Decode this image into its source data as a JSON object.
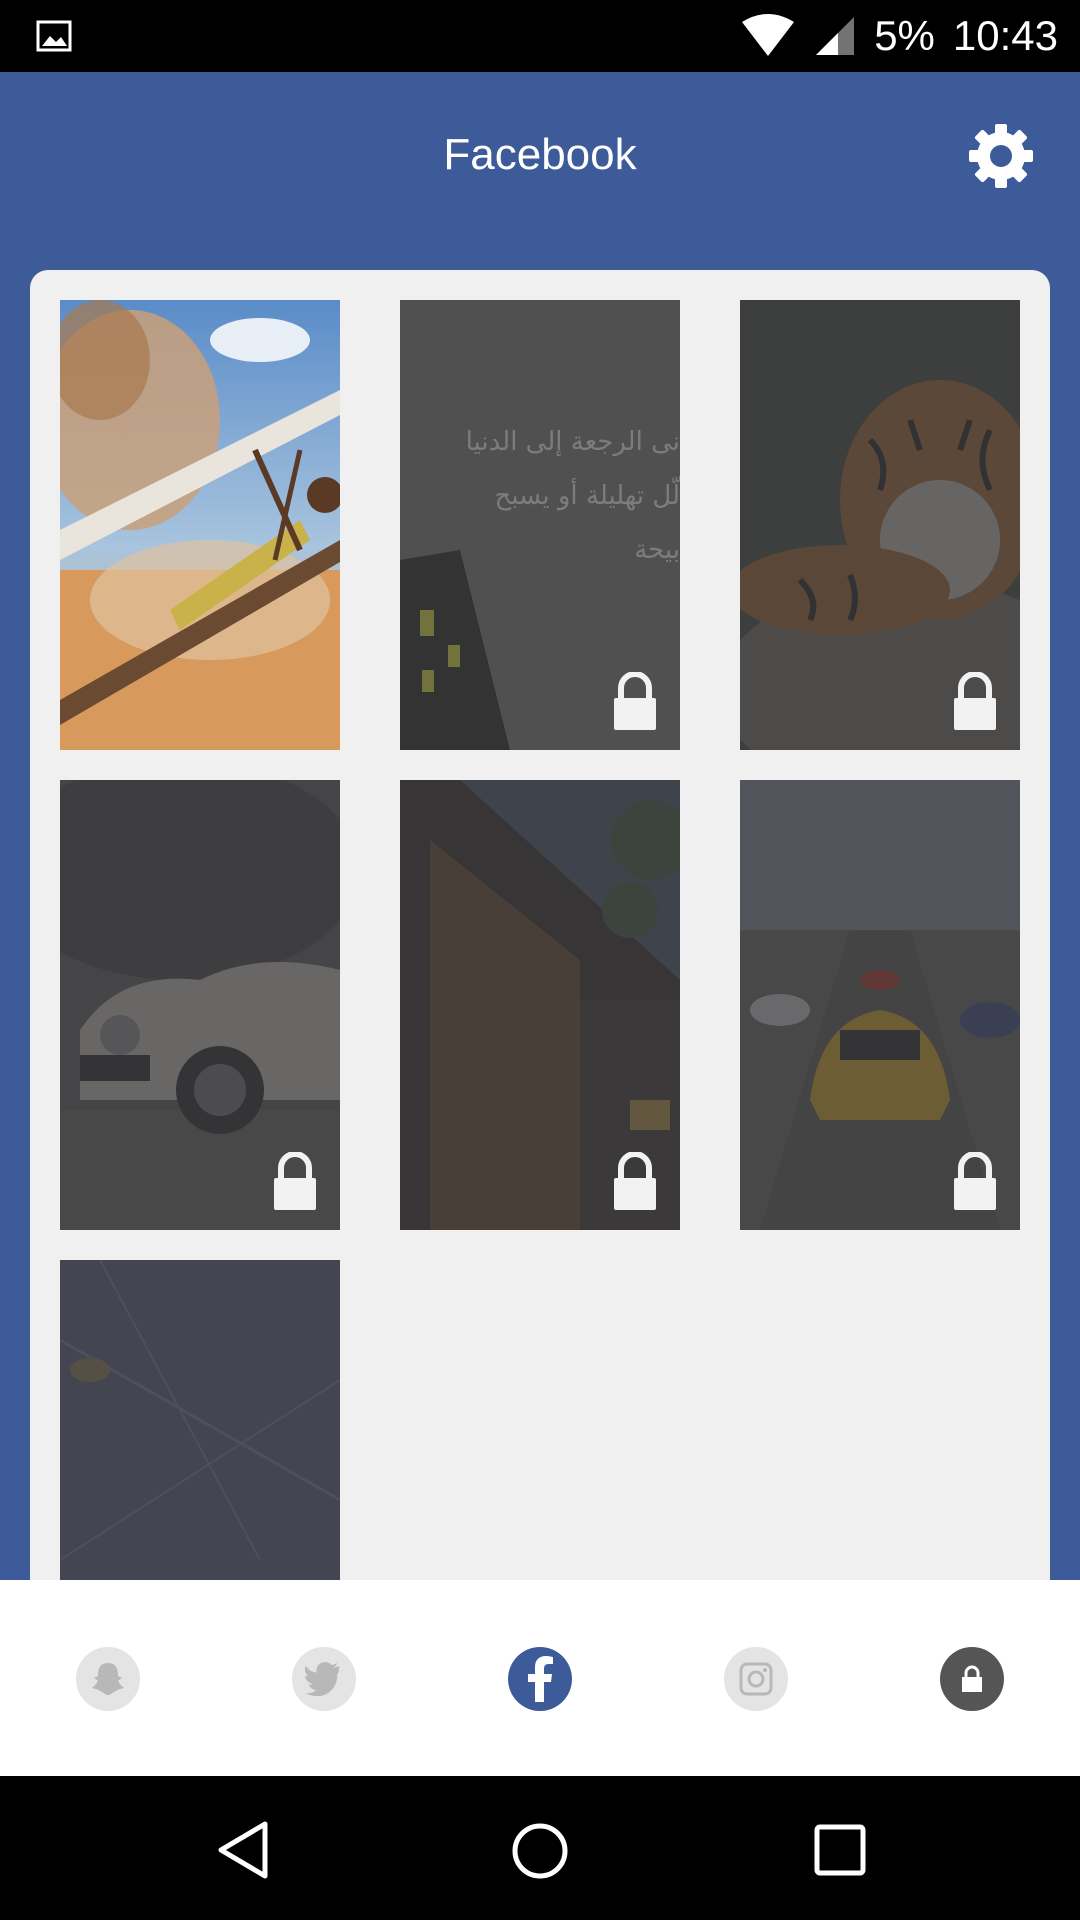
{
  "status_bar": {
    "battery": "5%",
    "time": "10:43",
    "icons": [
      "image-icon",
      "wifi-icon",
      "signal-icon"
    ]
  },
  "app_bar": {
    "title": "Facebook",
    "icons": [
      "settings-gear-icon"
    ]
  },
  "gallery": {
    "items": [
      {
        "subject": "biplane over desert",
        "locked": false
      },
      {
        "subject": "arabic text wallpaper",
        "locked": true,
        "overlay_text": [
          "نى الرجعة إلى الدنيا",
          "لّل تهليلة أو يسبح",
          "بيحة"
        ]
      },
      {
        "subject": "tiger on rock",
        "locked": true
      },
      {
        "subject": "vintage white car",
        "locked": true
      },
      {
        "subject": "modern building",
        "locked": true
      },
      {
        "subject": "yellow sports car race",
        "locked": true
      },
      {
        "subject": "dark abstract",
        "locked": true
      }
    ]
  },
  "bottom_nav": {
    "items": [
      {
        "name": "snapchat",
        "icon": "snapchat-ghost-icon",
        "active": false
      },
      {
        "name": "twitter",
        "icon": "twitter-bird-icon",
        "active": false
      },
      {
        "name": "facebook",
        "icon": "facebook-f-icon",
        "active": true
      },
      {
        "name": "instagram",
        "icon": "instagram-camera-icon",
        "active": false
      },
      {
        "name": "locked",
        "icon": "lock-icon",
        "active": false
      }
    ]
  },
  "system_nav": {
    "icons": [
      "back-icon",
      "home-icon",
      "recents-icon"
    ]
  },
  "colors": {
    "brand": "#3d5a99",
    "panel": "#f0f0f0",
    "status_bar": "#000000"
  }
}
